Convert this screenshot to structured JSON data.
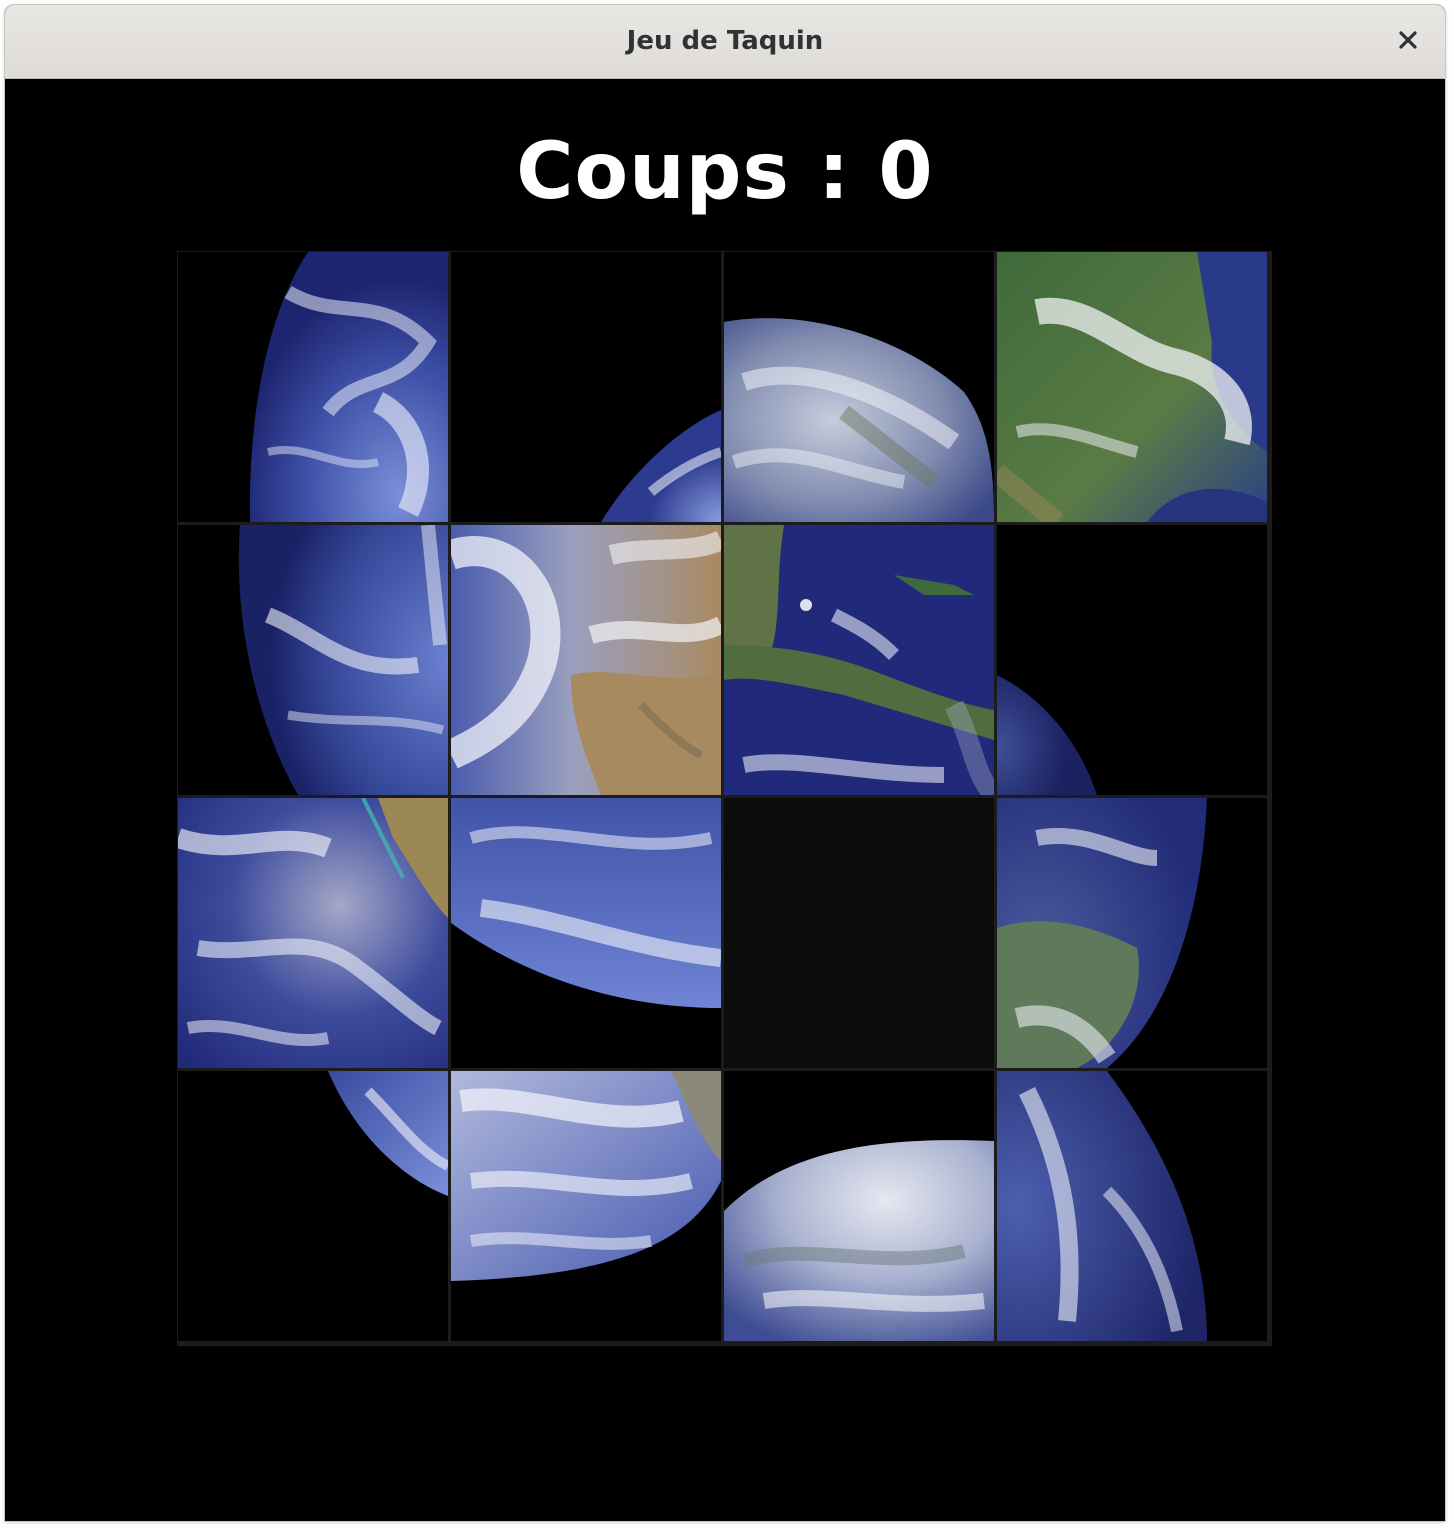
{
  "window": {
    "title": "Jeu de Taquin",
    "close_icon": "close-icon"
  },
  "game": {
    "moves_label": "Coups : 0",
    "moves": 0,
    "grid_size": 4,
    "empty_color": "#0c0c0c",
    "tiles": [
      {
        "row": 0,
        "col": 0,
        "piece": "earth-left-edge-top"
      },
      {
        "row": 0,
        "col": 1,
        "piece": "space-empty"
      },
      {
        "row": 0,
        "col": 2,
        "piece": "earth-arctic-top"
      },
      {
        "row": 0,
        "col": 3,
        "piece": "north-america-east"
      },
      {
        "row": 1,
        "col": 0,
        "piece": "earth-left-edge-middle"
      },
      {
        "row": 1,
        "col": 1,
        "piece": "north-america-west"
      },
      {
        "row": 1,
        "col": 2,
        "piece": "gulf-of-mexico"
      },
      {
        "row": 1,
        "col": 3,
        "piece": "space-earth-edge"
      },
      {
        "row": 2,
        "col": 0,
        "piece": "pacific-baja"
      },
      {
        "row": 2,
        "col": 1,
        "piece": "pacific-lower-edge"
      },
      {
        "row": 2,
        "col": 2,
        "piece": "empty-slot"
      },
      {
        "row": 2,
        "col": 3,
        "piece": "south-america-north"
      },
      {
        "row": 3,
        "col": 0,
        "piece": "earth-lower-left-edge"
      },
      {
        "row": 3,
        "col": 1,
        "piece": "pacific-clouds"
      },
      {
        "row": 3,
        "col": 2,
        "piece": "earth-arctic-bottom"
      },
      {
        "row": 3,
        "col": 3,
        "piece": "earth-right-edge-clouds"
      }
    ]
  }
}
